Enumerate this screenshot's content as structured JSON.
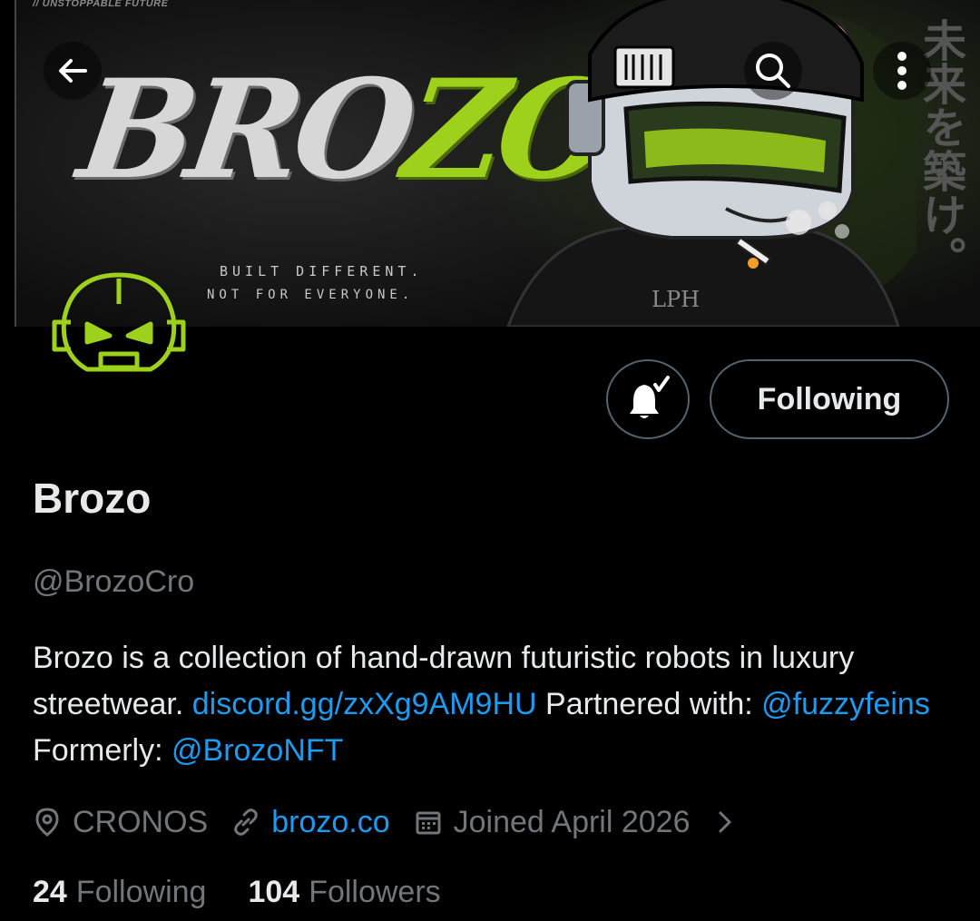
{
  "banner": {
    "tagline_top": "// UNSTOPPABLE FUTURE",
    "logo_part1": "BRO",
    "logo_part2": "ZO",
    "slogan_line1": "BUILT DIFFERENT.",
    "slogan_line2": "NOT FOR EVERYONE.",
    "jacket_text": "LPH",
    "japanese_text": "未来を築け。",
    "accent_color": "#9ed11b"
  },
  "toolbar": {
    "back_icon": "arrow-left-icon",
    "search_icon": "search-icon",
    "more_icon": "more-vertical-icon"
  },
  "actions": {
    "notify_icon": "bell-check-icon",
    "following_label": "Following"
  },
  "profile": {
    "display_name": "Brozo",
    "handle": "@BrozoCro",
    "bio": {
      "text1": "Brozo is a collection of hand-drawn futuristic robots in luxury streetwear.  ",
      "link1": "discord.gg/zxXg9AM9HU",
      "text2": " Partnered with: ",
      "mention1": "@fuzzyfeins",
      "text3": " Formerly: ",
      "mention2": "@BrozoNFT"
    },
    "location": "CRONOS",
    "website": "brozo.co",
    "joined": "Joined April 2026",
    "following_count": "24",
    "following_label": "Following",
    "followers_count": "104",
    "followers_label": "Followers"
  },
  "colors": {
    "link": "#1d9bf0",
    "muted": "#71767b",
    "text": "#e7e9ea",
    "border": "#536471"
  }
}
